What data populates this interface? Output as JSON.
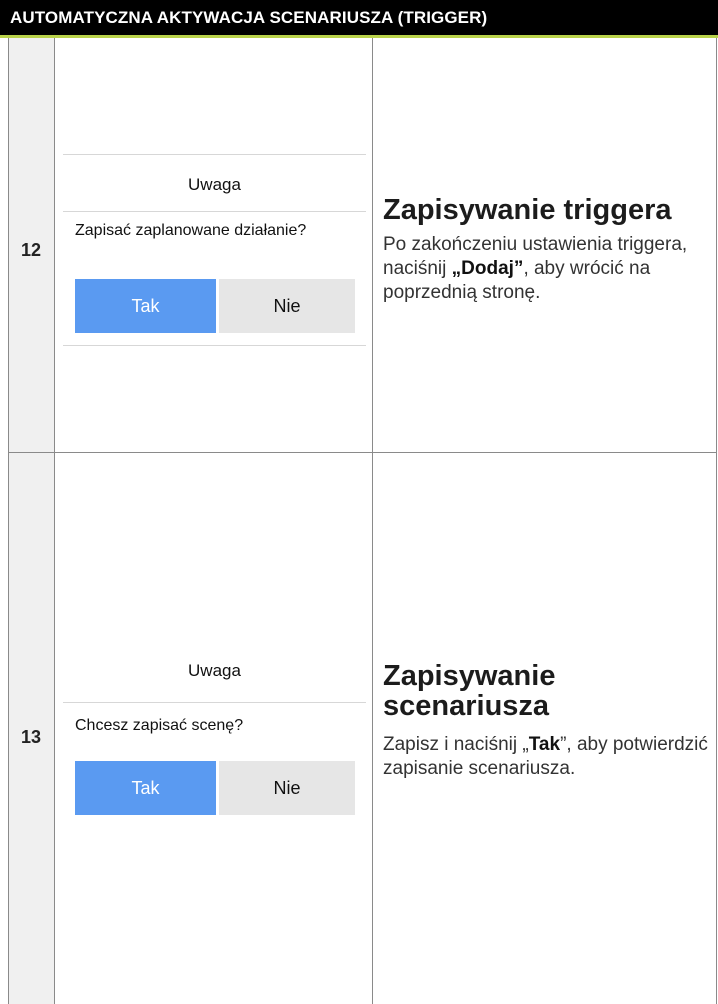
{
  "header": {
    "title": "AUTOMATYCZNA AKTYWACJA SCENARIUSZA (TRIGGER)"
  },
  "accent_color": "#b9d24a",
  "steps": [
    {
      "number": "12",
      "dialog": {
        "title": "Uwaga",
        "message": "Zapisać zaplanowane działanie?",
        "yes_label": "Tak",
        "no_label": "Nie"
      },
      "heading": "Zapisywanie triggera",
      "text_before": "Po zakończeniu ustawienia triggera, naciśnij ",
      "text_bold": "„Dodaj”",
      "text_after": ", aby wrócić na poprzednią stronę."
    },
    {
      "number": "13",
      "dialog": {
        "title": "Uwaga",
        "message": "Chcesz zapisać scenę?",
        "yes_label": "Tak",
        "no_label": "Nie"
      },
      "heading": "Zapisywanie scenariusza",
      "text_before": "Zapisz i naciśnij „",
      "text_bold": "Tak",
      "text_after": "”, aby potwierdzić zapisanie scenariusza."
    }
  ]
}
